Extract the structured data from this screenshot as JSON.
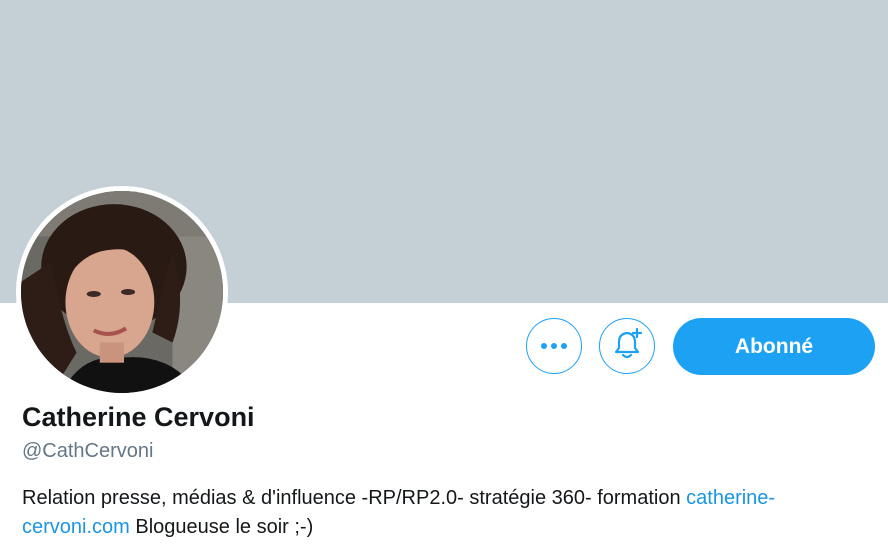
{
  "profile": {
    "name": "Catherine Cervoni",
    "handle": "@CathCervoni",
    "bio": {
      "text_before": "Relation presse, médias & d'influence -RP/RP2.0- stratégie 360- formation ",
      "link_text": "catherine-cervoni.com",
      "text_after": " Blogueuse le soir ;-)"
    }
  },
  "actions": {
    "more_icon": "more-horizontal-icon",
    "notify_icon": "bell-plus-icon",
    "follow_label": "Abonné"
  },
  "colors": {
    "banner": "#c4cfd6",
    "accent": "#1da1f2",
    "link": "#1b95e0",
    "secondary_text": "#657786"
  }
}
